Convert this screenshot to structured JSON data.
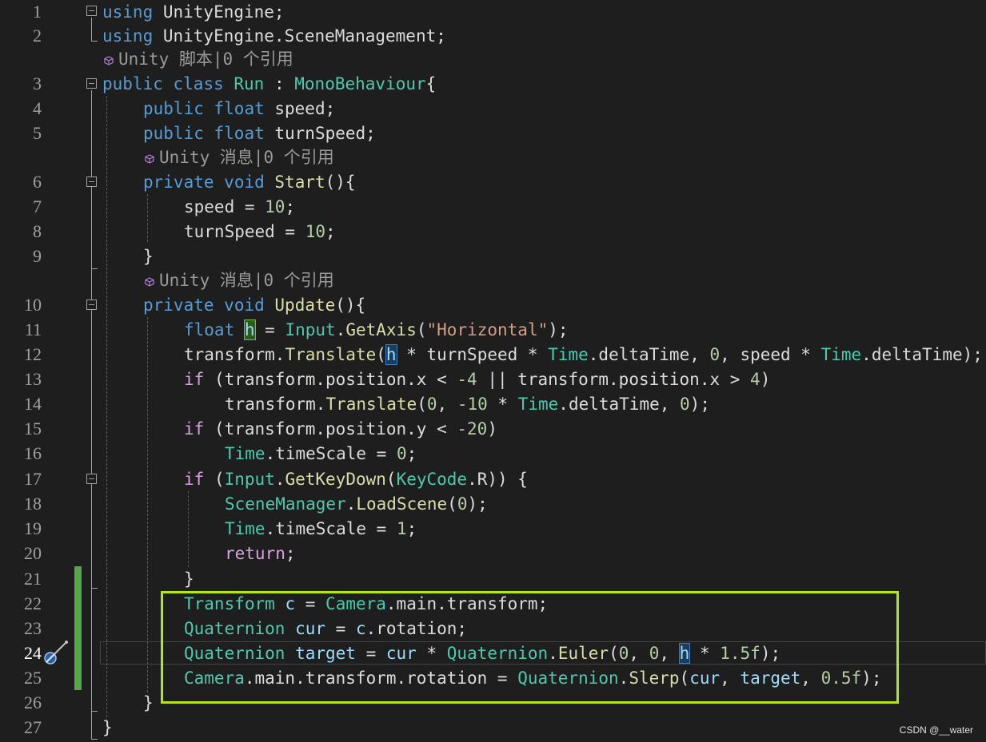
{
  "editor": {
    "active_line": "24",
    "line_numbers": [
      "1",
      "2",
      "3",
      "4",
      "5",
      "6",
      "7",
      "8",
      "9",
      "10",
      "11",
      "12",
      "13",
      "14",
      "15",
      "16",
      "17",
      "18",
      "19",
      "20",
      "21",
      "22",
      "23",
      "24",
      "25",
      "26",
      "27"
    ],
    "codelens": {
      "script": "Unity 脚本|0 个引用",
      "message1": "Unity 消息|0 个引用",
      "message2": "Unity 消息|0 个引用"
    }
  },
  "code": {
    "l1": [
      "using",
      " UnityEngine;"
    ],
    "l2": [
      "using",
      " UnityEngine.SceneManagement;"
    ],
    "l3": [
      "public",
      " ",
      "class",
      " ",
      "Run",
      " : ",
      "MonoBehaviour",
      "{"
    ],
    "l4": [
      "public",
      " ",
      "float",
      " speed;"
    ],
    "l5": [
      "public",
      " ",
      "float",
      " turnSpeed;"
    ],
    "l6": [
      "private",
      " ",
      "void",
      " ",
      "Start",
      "(){"
    ],
    "l7": [
      "speed = ",
      "10",
      ";"
    ],
    "l8": [
      "turnSpeed = ",
      "10",
      ";"
    ],
    "l9": [
      "}"
    ],
    "l10": [
      "private",
      " ",
      "void",
      " ",
      "Update",
      "(){"
    ],
    "l11": [
      "float",
      " ",
      "h",
      " = ",
      "Input",
      ".",
      "GetAxis",
      "(",
      "\"Horizontal\"",
      ");"
    ],
    "l12": [
      "transform.",
      "Translate",
      "(",
      "h",
      " * turnSpeed * ",
      "Time",
      ".deltaTime, ",
      "0",
      ", speed * ",
      "Time",
      ".deltaTime);"
    ],
    "l13": [
      "if",
      " (transform.position.x < ",
      "-4",
      " || transform.position.x > ",
      "4",
      ")"
    ],
    "l14": [
      "transform.",
      "Translate",
      "(",
      "0",
      ", ",
      "-10",
      " * ",
      "Time",
      ".deltaTime, ",
      "0",
      ");"
    ],
    "l15": [
      "if",
      " (transform.position.y < ",
      "-20",
      ")"
    ],
    "l16": [
      "Time",
      ".timeScale = ",
      "0",
      ";"
    ],
    "l17": [
      "if",
      " (",
      "Input",
      ".",
      "GetKeyDown",
      "(",
      "KeyCode",
      ".R)) {"
    ],
    "l18": [
      "SceneManager",
      ".",
      "LoadScene",
      "(",
      "0",
      ");"
    ],
    "l19": [
      "Time",
      ".timeScale = ",
      "1",
      ";"
    ],
    "l20": [
      "return",
      ";"
    ],
    "l21": [
      "}"
    ],
    "l22": [
      "Transform",
      " ",
      "c",
      " = ",
      "Camera",
      ".main.transform;"
    ],
    "l23": [
      "Quaternion",
      " ",
      "cur",
      " = ",
      "c",
      ".rotation;"
    ],
    "l24": [
      "Quaternion",
      " ",
      "target",
      " = ",
      "cur",
      " * ",
      "Quaternion",
      ".",
      "Euler",
      "(",
      "0",
      ", ",
      "0",
      ", ",
      "h",
      " * ",
      "1.5f",
      ");"
    ],
    "l25": [
      "Camera",
      ".main.transform.rotation = ",
      "Quaternion",
      ".",
      "Slerp",
      "(",
      "cur",
      ", ",
      "target",
      ", ",
      "0.5f",
      ");"
    ],
    "l26": [
      "}"
    ],
    "l27": [
      "}"
    ]
  },
  "watermark": "CSDN @__water",
  "colors": {
    "background": "#1e1e1e",
    "keyword": "#569cd6",
    "control": "#d8a0df",
    "type": "#4ec9b0",
    "method": "#dcdcaa",
    "string": "#d69d85",
    "number": "#b5cea8",
    "local": "#9cdcfe",
    "changed_margin": "#57a64a",
    "annotation_box": "#b5e61d"
  }
}
